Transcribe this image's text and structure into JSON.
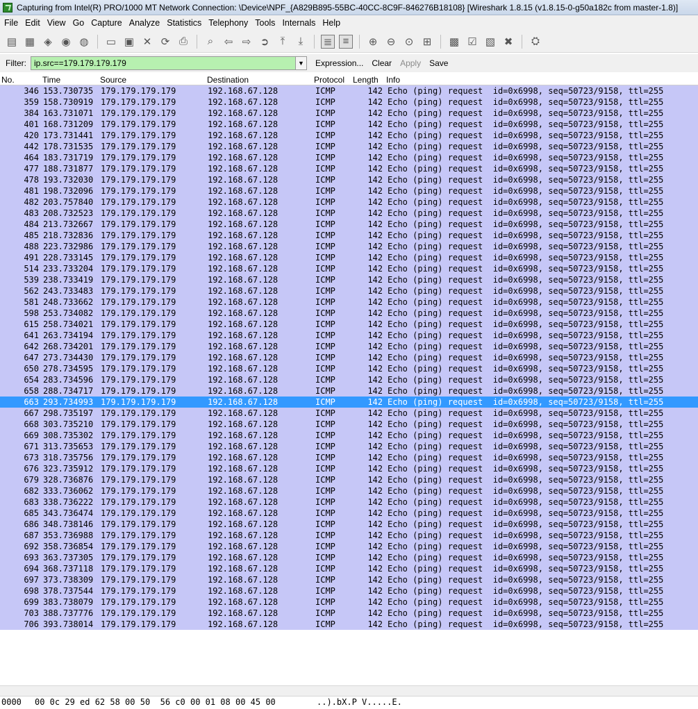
{
  "window": {
    "title": "Capturing from Intel(R) PRO/1000 MT Network Connection: \\Device\\NPF_{A829B895-55BC-40CC-8C9F-846276B18108}   [Wireshark 1.8.15  (v1.8.15-0-g50a182c from master-1.8)]",
    "icon": "wireshark-fin-icon"
  },
  "menu": [
    {
      "label": "File"
    },
    {
      "label": "Edit"
    },
    {
      "label": "View"
    },
    {
      "label": "Go"
    },
    {
      "label": "Capture"
    },
    {
      "label": "Analyze"
    },
    {
      "label": "Statistics"
    },
    {
      "label": "Telephony"
    },
    {
      "label": "Tools"
    },
    {
      "label": "Internals"
    },
    {
      "label": "Help"
    }
  ],
  "toolbar": [
    {
      "name": "interfaces-icon",
      "glyph": "▤"
    },
    {
      "name": "capture-options-icon",
      "glyph": "▦"
    },
    {
      "name": "start-capture-icon",
      "glyph": "◈"
    },
    {
      "name": "stop-capture-icon",
      "glyph": "◉"
    },
    {
      "name": "restart-capture-icon",
      "glyph": "◍"
    },
    {
      "name": "sep"
    },
    {
      "name": "open-file-icon",
      "glyph": "▭"
    },
    {
      "name": "save-file-icon",
      "glyph": "▣"
    },
    {
      "name": "close-file-icon",
      "glyph": "✕"
    },
    {
      "name": "reload-icon",
      "glyph": "⟳"
    },
    {
      "name": "print-icon",
      "glyph": "⎙"
    },
    {
      "name": "sep"
    },
    {
      "name": "find-packet-icon",
      "glyph": "⌕"
    },
    {
      "name": "go-back-icon",
      "glyph": "⇦"
    },
    {
      "name": "go-forward-icon",
      "glyph": "⇨"
    },
    {
      "name": "go-to-packet-icon",
      "glyph": "➲"
    },
    {
      "name": "first-packet-icon",
      "glyph": "⤒"
    },
    {
      "name": "last-packet-icon",
      "glyph": "⤓"
    },
    {
      "name": "sep"
    },
    {
      "name": "colorize-icon",
      "glyph": "≣",
      "on": true
    },
    {
      "name": "auto-scroll-icon",
      "glyph": "≡",
      "on": true
    },
    {
      "name": "sep"
    },
    {
      "name": "zoom-in-icon",
      "glyph": "⊕"
    },
    {
      "name": "zoom-out-icon",
      "glyph": "⊖"
    },
    {
      "name": "normal-size-icon",
      "glyph": "⊙"
    },
    {
      "name": "resize-columns-icon",
      "glyph": "⊞"
    },
    {
      "name": "sep"
    },
    {
      "name": "capture-filters-icon",
      "glyph": "▩"
    },
    {
      "name": "display-filters-icon",
      "glyph": "☑"
    },
    {
      "name": "coloring-rules-icon",
      "glyph": "▧"
    },
    {
      "name": "preferences-icon",
      "glyph": "✖"
    },
    {
      "name": "sep"
    },
    {
      "name": "help-icon",
      "glyph": "⛭"
    }
  ],
  "filter": {
    "label": "Filter:",
    "value": "ip.src==179.179.179.179",
    "expression": "Expression...",
    "clear": "Clear",
    "apply": "Apply",
    "save": "Save"
  },
  "columns": {
    "no": "No.",
    "time": "Time",
    "source": "Source",
    "destination": "Destination",
    "protocol": "Protocol",
    "length": "Length",
    "info": "Info"
  },
  "packets": [
    {
      "no": "346",
      "time": "153.730735",
      "src": "179.179.179.179",
      "dst": "192.168.67.128",
      "proto": "ICMP",
      "len": "142",
      "info": "Echo (ping) request  id=0x6998, seq=50723/9158, ttl=255"
    },
    {
      "no": "359",
      "time": "158.730919",
      "src": "179.179.179.179",
      "dst": "192.168.67.128",
      "proto": "ICMP",
      "len": "142",
      "info": "Echo (ping) request  id=0x6998, seq=50723/9158, ttl=255"
    },
    {
      "no": "384",
      "time": "163.731071",
      "src": "179.179.179.179",
      "dst": "192.168.67.128",
      "proto": "ICMP",
      "len": "142",
      "info": "Echo (ping) request  id=0x6998, seq=50723/9158, ttl=255"
    },
    {
      "no": "401",
      "time": "168.731209",
      "src": "179.179.179.179",
      "dst": "192.168.67.128",
      "proto": "ICMP",
      "len": "142",
      "info": "Echo (ping) request  id=0x6998, seq=50723/9158, ttl=255"
    },
    {
      "no": "420",
      "time": "173.731441",
      "src": "179.179.179.179",
      "dst": "192.168.67.128",
      "proto": "ICMP",
      "len": "142",
      "info": "Echo (ping) request  id=0x6998, seq=50723/9158, ttl=255"
    },
    {
      "no": "442",
      "time": "178.731535",
      "src": "179.179.179.179",
      "dst": "192.168.67.128",
      "proto": "ICMP",
      "len": "142",
      "info": "Echo (ping) request  id=0x6998, seq=50723/9158, ttl=255"
    },
    {
      "no": "464",
      "time": "183.731719",
      "src": "179.179.179.179",
      "dst": "192.168.67.128",
      "proto": "ICMP",
      "len": "142",
      "info": "Echo (ping) request  id=0x6998, seq=50723/9158, ttl=255"
    },
    {
      "no": "477",
      "time": "188.731877",
      "src": "179.179.179.179",
      "dst": "192.168.67.128",
      "proto": "ICMP",
      "len": "142",
      "info": "Echo (ping) request  id=0x6998, seq=50723/9158, ttl=255"
    },
    {
      "no": "478",
      "time": "193.732030",
      "src": "179.179.179.179",
      "dst": "192.168.67.128",
      "proto": "ICMP",
      "len": "142",
      "info": "Echo (ping) request  id=0x6998, seq=50723/9158, ttl=255"
    },
    {
      "no": "481",
      "time": "198.732096",
      "src": "179.179.179.179",
      "dst": "192.168.67.128",
      "proto": "ICMP",
      "len": "142",
      "info": "Echo (ping) request  id=0x6998, seq=50723/9158, ttl=255"
    },
    {
      "no": "482",
      "time": "203.757840",
      "src": "179.179.179.179",
      "dst": "192.168.67.128",
      "proto": "ICMP",
      "len": "142",
      "info": "Echo (ping) request  id=0x6998, seq=50723/9158, ttl=255"
    },
    {
      "no": "483",
      "time": "208.732523",
      "src": "179.179.179.179",
      "dst": "192.168.67.128",
      "proto": "ICMP",
      "len": "142",
      "info": "Echo (ping) request  id=0x6998, seq=50723/9158, ttl=255"
    },
    {
      "no": "484",
      "time": "213.732667",
      "src": "179.179.179.179",
      "dst": "192.168.67.128",
      "proto": "ICMP",
      "len": "142",
      "info": "Echo (ping) request  id=0x6998, seq=50723/9158, ttl=255"
    },
    {
      "no": "485",
      "time": "218.732836",
      "src": "179.179.179.179",
      "dst": "192.168.67.128",
      "proto": "ICMP",
      "len": "142",
      "info": "Echo (ping) request  id=0x6998, seq=50723/9158, ttl=255"
    },
    {
      "no": "488",
      "time": "223.732986",
      "src": "179.179.179.179",
      "dst": "192.168.67.128",
      "proto": "ICMP",
      "len": "142",
      "info": "Echo (ping) request  id=0x6998, seq=50723/9158, ttl=255"
    },
    {
      "no": "491",
      "time": "228.733145",
      "src": "179.179.179.179",
      "dst": "192.168.67.128",
      "proto": "ICMP",
      "len": "142",
      "info": "Echo (ping) request  id=0x6998, seq=50723/9158, ttl=255"
    },
    {
      "no": "514",
      "time": "233.733204",
      "src": "179.179.179.179",
      "dst": "192.168.67.128",
      "proto": "ICMP",
      "len": "142",
      "info": "Echo (ping) request  id=0x6998, seq=50723/9158, ttl=255"
    },
    {
      "no": "539",
      "time": "238.733419",
      "src": "179.179.179.179",
      "dst": "192.168.67.128",
      "proto": "ICMP",
      "len": "142",
      "info": "Echo (ping) request  id=0x6998, seq=50723/9158, ttl=255"
    },
    {
      "no": "562",
      "time": "243.733483",
      "src": "179.179.179.179",
      "dst": "192.168.67.128",
      "proto": "ICMP",
      "len": "142",
      "info": "Echo (ping) request  id=0x6998, seq=50723/9158, ttl=255"
    },
    {
      "no": "581",
      "time": "248.733662",
      "src": "179.179.179.179",
      "dst": "192.168.67.128",
      "proto": "ICMP",
      "len": "142",
      "info": "Echo (ping) request  id=0x6998, seq=50723/9158, ttl=255"
    },
    {
      "no": "598",
      "time": "253.734082",
      "src": "179.179.179.179",
      "dst": "192.168.67.128",
      "proto": "ICMP",
      "len": "142",
      "info": "Echo (ping) request  id=0x6998, seq=50723/9158, ttl=255"
    },
    {
      "no": "615",
      "time": "258.734021",
      "src": "179.179.179.179",
      "dst": "192.168.67.128",
      "proto": "ICMP",
      "len": "142",
      "info": "Echo (ping) request  id=0x6998, seq=50723/9158, ttl=255"
    },
    {
      "no": "641",
      "time": "263.734194",
      "src": "179.179.179.179",
      "dst": "192.168.67.128",
      "proto": "ICMP",
      "len": "142",
      "info": "Echo (ping) request  id=0x6998, seq=50723/9158, ttl=255"
    },
    {
      "no": "642",
      "time": "268.734201",
      "src": "179.179.179.179",
      "dst": "192.168.67.128",
      "proto": "ICMP",
      "len": "142",
      "info": "Echo (ping) request  id=0x6998, seq=50723/9158, ttl=255"
    },
    {
      "no": "647",
      "time": "273.734430",
      "src": "179.179.179.179",
      "dst": "192.168.67.128",
      "proto": "ICMP",
      "len": "142",
      "info": "Echo (ping) request  id=0x6998, seq=50723/9158, ttl=255"
    },
    {
      "no": "650",
      "time": "278.734595",
      "src": "179.179.179.179",
      "dst": "192.168.67.128",
      "proto": "ICMP",
      "len": "142",
      "info": "Echo (ping) request  id=0x6998, seq=50723/9158, ttl=255"
    },
    {
      "no": "654",
      "time": "283.734596",
      "src": "179.179.179.179",
      "dst": "192.168.67.128",
      "proto": "ICMP",
      "len": "142",
      "info": "Echo (ping) request  id=0x6998, seq=50723/9158, ttl=255"
    },
    {
      "no": "658",
      "time": "288.734717",
      "src": "179.179.179.179",
      "dst": "192.168.67.128",
      "proto": "ICMP",
      "len": "142",
      "info": "Echo (ping) request  id=0x6998, seq=50723/9158, ttl=255"
    },
    {
      "no": "663",
      "time": "293.734993",
      "src": "179.179.179.179",
      "dst": "192.168.67.128",
      "proto": "ICMP",
      "len": "142",
      "info": "Echo (ping) request  id=0x6998, seq=50723/9158, ttl=255",
      "selected": true
    },
    {
      "no": "667",
      "time": "298.735197",
      "src": "179.179.179.179",
      "dst": "192.168.67.128",
      "proto": "ICMP",
      "len": "142",
      "info": "Echo (ping) request  id=0x6998, seq=50723/9158, ttl=255"
    },
    {
      "no": "668",
      "time": "303.735210",
      "src": "179.179.179.179",
      "dst": "192.168.67.128",
      "proto": "ICMP",
      "len": "142",
      "info": "Echo (ping) request  id=0x6998, seq=50723/9158, ttl=255"
    },
    {
      "no": "669",
      "time": "308.735302",
      "src": "179.179.179.179",
      "dst": "192.168.67.128",
      "proto": "ICMP",
      "len": "142",
      "info": "Echo (ping) request  id=0x6998, seq=50723/9158, ttl=255"
    },
    {
      "no": "671",
      "time": "313.735653",
      "src": "179.179.179.179",
      "dst": "192.168.67.128",
      "proto": "ICMP",
      "len": "142",
      "info": "Echo (ping) request  id=0x6998, seq=50723/9158, ttl=255"
    },
    {
      "no": "673",
      "time": "318.735756",
      "src": "179.179.179.179",
      "dst": "192.168.67.128",
      "proto": "ICMP",
      "len": "142",
      "info": "Echo (ping) request  id=0x6998, seq=50723/9158, ttl=255"
    },
    {
      "no": "676",
      "time": "323.735912",
      "src": "179.179.179.179",
      "dst": "192.168.67.128",
      "proto": "ICMP",
      "len": "142",
      "info": "Echo (ping) request  id=0x6998, seq=50723/9158, ttl=255"
    },
    {
      "no": "679",
      "time": "328.736876",
      "src": "179.179.179.179",
      "dst": "192.168.67.128",
      "proto": "ICMP",
      "len": "142",
      "info": "Echo (ping) request  id=0x6998, seq=50723/9158, ttl=255"
    },
    {
      "no": "682",
      "time": "333.736062",
      "src": "179.179.179.179",
      "dst": "192.168.67.128",
      "proto": "ICMP",
      "len": "142",
      "info": "Echo (ping) request  id=0x6998, seq=50723/9158, ttl=255"
    },
    {
      "no": "683",
      "time": "338.736222",
      "src": "179.179.179.179",
      "dst": "192.168.67.128",
      "proto": "ICMP",
      "len": "142",
      "info": "Echo (ping) request  id=0x6998, seq=50723/9158, ttl=255"
    },
    {
      "no": "685",
      "time": "343.736474",
      "src": "179.179.179.179",
      "dst": "192.168.67.128",
      "proto": "ICMP",
      "len": "142",
      "info": "Echo (ping) request  id=0x6998, seq=50723/9158, ttl=255"
    },
    {
      "no": "686",
      "time": "348.738146",
      "src": "179.179.179.179",
      "dst": "192.168.67.128",
      "proto": "ICMP",
      "len": "142",
      "info": "Echo (ping) request  id=0x6998, seq=50723/9158, ttl=255"
    },
    {
      "no": "687",
      "time": "353.736988",
      "src": "179.179.179.179",
      "dst": "192.168.67.128",
      "proto": "ICMP",
      "len": "142",
      "info": "Echo (ping) request  id=0x6998, seq=50723/9158, ttl=255"
    },
    {
      "no": "692",
      "time": "358.736854",
      "src": "179.179.179.179",
      "dst": "192.168.67.128",
      "proto": "ICMP",
      "len": "142",
      "info": "Echo (ping) request  id=0x6998, seq=50723/9158, ttl=255"
    },
    {
      "no": "693",
      "time": "363.737305",
      "src": "179.179.179.179",
      "dst": "192.168.67.128",
      "proto": "ICMP",
      "len": "142",
      "info": "Echo (ping) request  id=0x6998, seq=50723/9158, ttl=255"
    },
    {
      "no": "694",
      "time": "368.737118",
      "src": "179.179.179.179",
      "dst": "192.168.67.128",
      "proto": "ICMP",
      "len": "142",
      "info": "Echo (ping) request  id=0x6998, seq=50723/9158, ttl=255"
    },
    {
      "no": "697",
      "time": "373.738309",
      "src": "179.179.179.179",
      "dst": "192.168.67.128",
      "proto": "ICMP",
      "len": "142",
      "info": "Echo (ping) request  id=0x6998, seq=50723/9158, ttl=255"
    },
    {
      "no": "698",
      "time": "378.737544",
      "src": "179.179.179.179",
      "dst": "192.168.67.128",
      "proto": "ICMP",
      "len": "142",
      "info": "Echo (ping) request  id=0x6998, seq=50723/9158, ttl=255"
    },
    {
      "no": "699",
      "time": "383.738079",
      "src": "179.179.179.179",
      "dst": "192.168.67.128",
      "proto": "ICMP",
      "len": "142",
      "info": "Echo (ping) request  id=0x6998, seq=50723/9158, ttl=255"
    },
    {
      "no": "703",
      "time": "388.737776",
      "src": "179.179.179.179",
      "dst": "192.168.67.128",
      "proto": "ICMP",
      "len": "142",
      "info": "Echo (ping) request  id=0x6998, seq=50723/9158, ttl=255"
    },
    {
      "no": "706",
      "time": "393.738014",
      "src": "179.179.179.179",
      "dst": "192.168.67.128",
      "proto": "ICMP",
      "len": "142",
      "info": "Echo (ping) request  id=0x6998, seq=50723/9158, ttl=255"
    }
  ],
  "hex": {
    "offset": "0000",
    "bytes": "00 0c 29 ed 62 58 00 50  56 c0 00 01 08 00 45 00",
    "ascii": "..).bX.P V.....E."
  },
  "colors": {
    "row_bg": "#c6c7f7",
    "selected_bg": "#3399ff",
    "filter_bg": "#b7f0b0"
  }
}
